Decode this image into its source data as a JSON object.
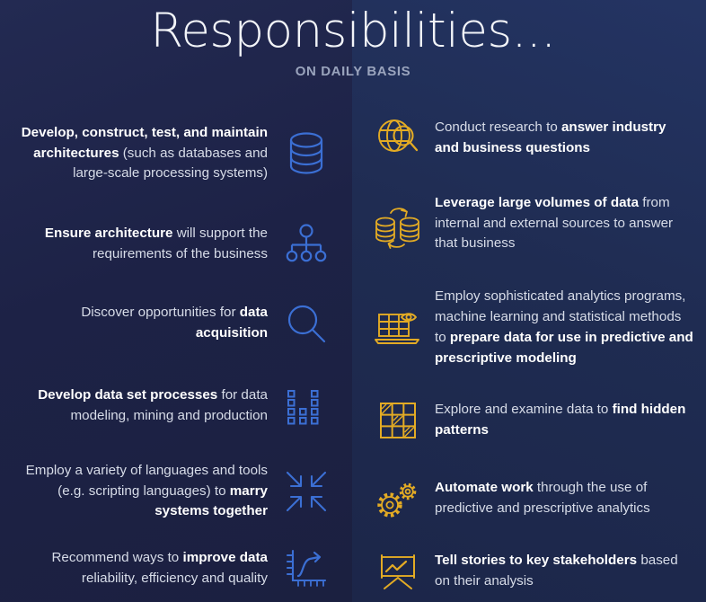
{
  "header": {
    "title": "Responsibilities...",
    "subtitle": "ON DAILY BASIS"
  },
  "colors": {
    "background_left": "#1e2347",
    "background_right": "#1f2c52",
    "icon_left": "#3b6fd4",
    "icon_right": "#e3ab24",
    "text_regular": "#d7dce8",
    "text_bold": "#ffffff",
    "subtitle": "#9aa4bd"
  },
  "left_column": {
    "items": [
      {
        "icon": "database-icon",
        "segments": [
          {
            "text": "Develop, construct, test, and maintain architectures",
            "bold": true
          },
          {
            "text": " (such as databases and large-scale processing systems)",
            "bold": false
          }
        ]
      },
      {
        "icon": "hierarchy-icon",
        "segments": [
          {
            "text": "Ensure architecture",
            "bold": true
          },
          {
            "text": " will support the requirements of the business",
            "bold": false
          }
        ]
      },
      {
        "icon": "magnifier-icon",
        "segments": [
          {
            "text": "Discover opportunities for ",
            "bold": false
          },
          {
            "text": "data acquisition",
            "bold": true
          }
        ]
      },
      {
        "icon": "dot-matrix-icon",
        "segments": [
          {
            "text": "Develop data set processes",
            "bold": true
          },
          {
            "text": " for data modeling, mining and production",
            "bold": false
          }
        ]
      },
      {
        "icon": "converging-arrows-icon",
        "segments": [
          {
            "text": "Employ a variety of languages and tools (e.g. scripting languages) to ",
            "bold": false
          },
          {
            "text": "marry systems together",
            "bold": true
          }
        ]
      },
      {
        "icon": "growth-chart-icon",
        "segments": [
          {
            "text": "Recommend ways to ",
            "bold": false
          },
          {
            "text": "improve data",
            "bold": true
          },
          {
            "text": " reliability, efficiency and quality",
            "bold": false
          }
        ]
      }
    ]
  },
  "right_column": {
    "items": [
      {
        "icon": "globe-search-icon",
        "segments": [
          {
            "text": "Conduct research to ",
            "bold": false
          },
          {
            "text": "answer industry and business questions",
            "bold": true
          }
        ]
      },
      {
        "icon": "database-sync-icon",
        "segments": [
          {
            "text": "Leverage large volumes of data",
            "bold": true
          },
          {
            "text": " from internal and external sources to answer that business",
            "bold": false
          }
        ]
      },
      {
        "icon": "analytics-board-icon",
        "segments": [
          {
            "text": "Employ sophisticated analytics programs, machine learning and statistical methods to ",
            "bold": false
          },
          {
            "text": "prepare data for use in predictive and prescriptive modeling",
            "bold": true
          }
        ]
      },
      {
        "icon": "pattern-grid-icon",
        "segments": [
          {
            "text": "Explore and examine data to ",
            "bold": false
          },
          {
            "text": "find hidden patterns",
            "bold": true
          }
        ]
      },
      {
        "icon": "gears-icon",
        "segments": [
          {
            "text": "Automate work",
            "bold": true
          },
          {
            "text": " through the use of predictive and prescriptive analytics",
            "bold": false
          }
        ]
      },
      {
        "icon": "presentation-chart-icon",
        "segments": [
          {
            "text": "Tell stories to key stakeholders",
            "bold": true
          },
          {
            "text": " based on their analysis",
            "bold": false
          }
        ]
      }
    ]
  }
}
